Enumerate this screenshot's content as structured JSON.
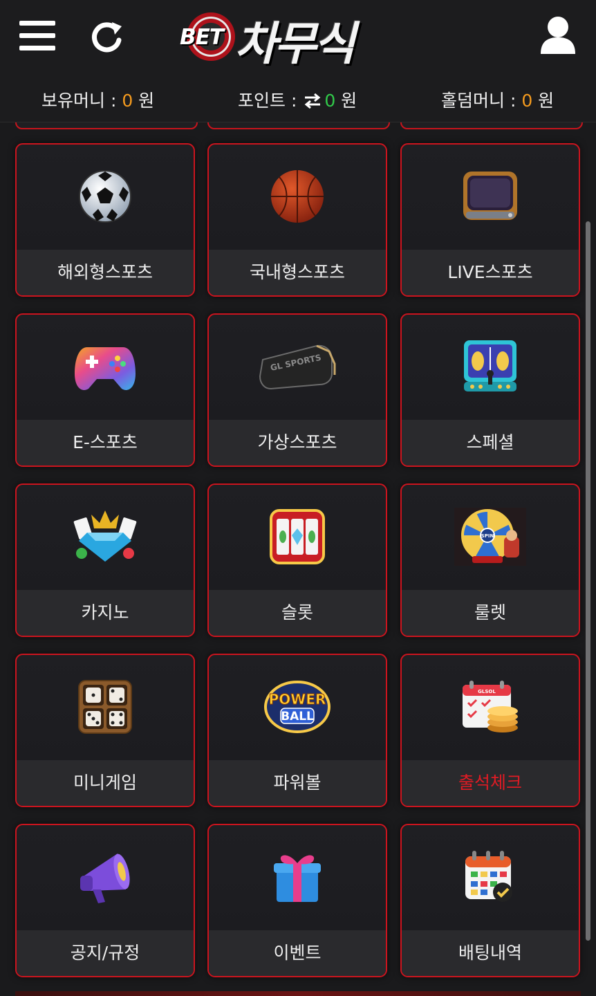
{
  "header": {
    "logo_prefix": "BET",
    "logo_name": "차무식"
  },
  "balance": {
    "money_label": "보유머니 : ",
    "money_value": "0",
    "money_unit": " 원",
    "points_label": "포인트 : ",
    "points_value": "0",
    "points_unit": " 원",
    "holdem_label": "홀덤머니 : ",
    "holdem_value": "0",
    "holdem_unit": " 원"
  },
  "menu": {
    "items": [
      {
        "label": "해외형스포츠",
        "icon": "soccer-ball-icon"
      },
      {
        "label": "국내형스포츠",
        "icon": "basketball-icon"
      },
      {
        "label": "LIVE스포츠",
        "icon": "tv-icon"
      },
      {
        "label": "E-스포츠",
        "icon": "gamepad-icon"
      },
      {
        "label": "가상스포츠",
        "icon": "vr-headset-icon"
      },
      {
        "label": "스페셜",
        "icon": "arcade-icon"
      },
      {
        "label": "카지노",
        "icon": "casino-diamond-icon"
      },
      {
        "label": "슬롯",
        "icon": "slot-machine-icon"
      },
      {
        "label": "룰렛",
        "icon": "roulette-wheel-icon"
      },
      {
        "label": "미니게임",
        "icon": "dice-icon"
      },
      {
        "label": "파워볼",
        "icon": "powerball-icon"
      },
      {
        "label": "출석체크",
        "icon": "attendance-calendar-icon"
      },
      {
        "label": "공지/규정",
        "icon": "megaphone-icon"
      },
      {
        "label": "이벤트",
        "icon": "gift-box-icon"
      },
      {
        "label": "배팅내역",
        "icon": "betting-calendar-icon"
      }
    ],
    "powerball_top": "POWER",
    "powerball_bottom": "BALL",
    "vr_text": "GL SPORTS",
    "roulette_center": "SPIN",
    "attendance_tag": "GLSOL"
  },
  "colors": {
    "accent_red": "#cc141e",
    "money_orange": "#f39a1e",
    "points_green": "#31c94a",
    "highlight_label": "#e01b24"
  }
}
